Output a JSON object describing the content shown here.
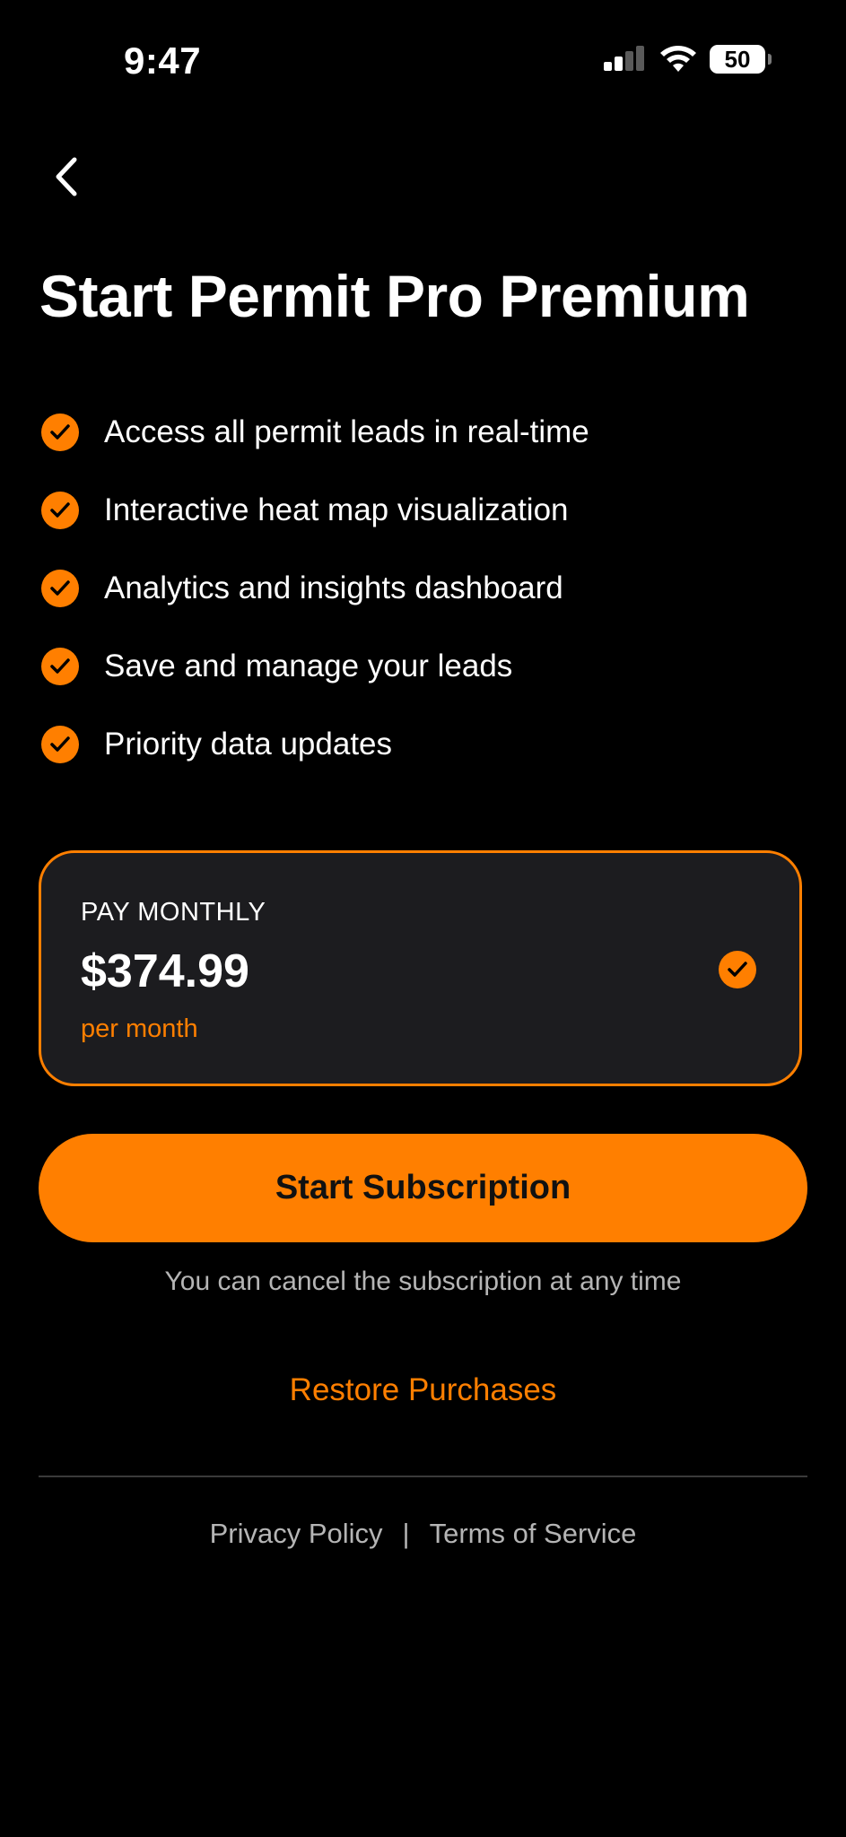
{
  "status_bar": {
    "time": "9:47",
    "battery": "50",
    "icons": [
      "signal-icon",
      "wifi-icon",
      "battery-icon"
    ]
  },
  "nav": {
    "back_icon": "chevron-left-icon"
  },
  "header": {
    "title": "Start Permit Pro Premium"
  },
  "features": [
    {
      "label": "Access all permit leads in real-time",
      "icon": "check-circle-icon"
    },
    {
      "label": "Interactive heat map visualization",
      "icon": "check-circle-icon"
    },
    {
      "label": "Analytics and insights dashboard",
      "icon": "check-circle-icon"
    },
    {
      "label": "Save and manage your leads",
      "icon": "check-circle-icon"
    },
    {
      "label": "Priority data updates",
      "icon": "check-circle-icon"
    }
  ],
  "plan": {
    "name": "PAY MONTHLY",
    "price": "$374.99",
    "period": "per month",
    "selected": true
  },
  "actions": {
    "subscribe_label": "Start Subscription",
    "cancel_note": "You can cancel the subscription at any time",
    "restore_label": "Restore Purchases"
  },
  "footer": {
    "privacy_label": "Privacy Policy",
    "separator": "|",
    "terms_label": "Terms of Service"
  },
  "colors": {
    "background": "#000000",
    "accent": "#FF7F00",
    "card_background": "#1C1C1F",
    "muted_text": "#B5B5B5"
  }
}
